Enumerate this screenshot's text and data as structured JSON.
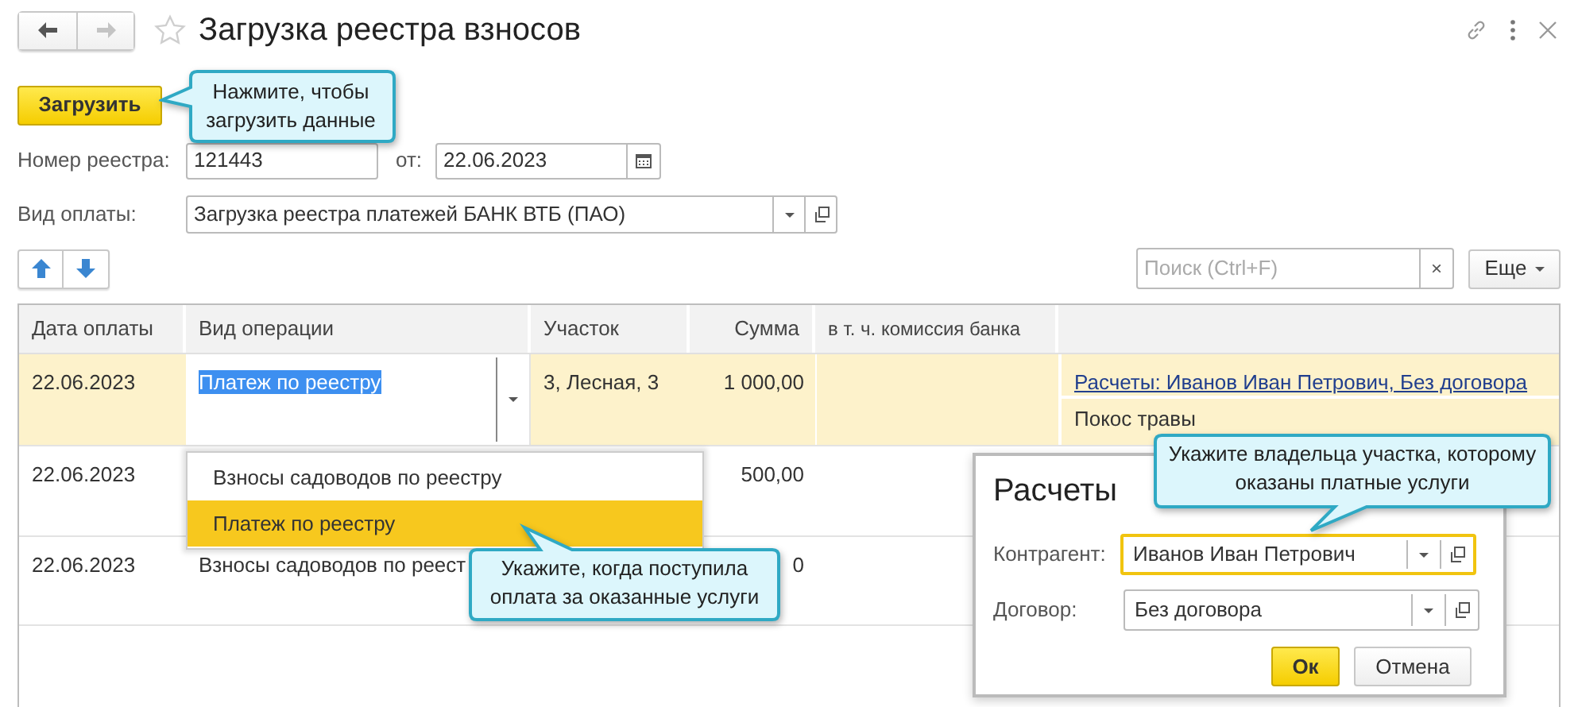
{
  "window": {
    "title": "Загрузка реестра взносов"
  },
  "navigation": [
    {
      "kind": "back",
      "disabled": false
    },
    {
      "kind": "forward",
      "disabled": true
    }
  ],
  "load_button": "Загрузить",
  "registry_number": {
    "label": "Номер реестра:",
    "value": "121443"
  },
  "date": {
    "label": "от:",
    "value": "22.06.2023"
  },
  "payment_type": {
    "label": "Вид оплаты:",
    "value": "Загрузка реестра платежей БАНК ВТБ (ПАО)"
  },
  "search": {
    "placeholder": "Поиск (Ctrl+F)",
    "clear": "×"
  },
  "more_button": "Еще",
  "table": {
    "columns": [
      "Дата оплаты",
      "Вид операции",
      "Участок",
      "Сумма",
      "в т. ч. комиссия банка"
    ],
    "rows": [
      {
        "date": "22.06.2023",
        "operation": "Платеж по реестру",
        "plot": "3, Лесная, 3",
        "sum": "1 000,00",
        "settlement": "Расчеты: Иванов Иван Петрович, Без договора",
        "service": "Покос травы",
        "selected": true
      },
      {
        "date": "22.06.2023",
        "sum": "500,00",
        "selected": false
      },
      {
        "date": "22.06.2023",
        "operation": "Взносы садоводов по реест",
        "sum": "0",
        "selected": false
      }
    ]
  },
  "operation_dropdown": {
    "items": [
      {
        "label": "Взносы садоводов по реестру",
        "selected": false
      },
      {
        "label": "Платеж по реестру",
        "selected": true
      }
    ]
  },
  "dialog": {
    "title": "Расчеты",
    "fields": [
      {
        "label": "Контрагент:",
        "value": "Иванов Иван Петрович",
        "focused": true
      },
      {
        "label": "Договор:",
        "value": "Без договора",
        "focused": false
      }
    ],
    "buttons": [
      {
        "label": "Ок",
        "kind": "primary"
      },
      {
        "label": "Отмена",
        "kind": "default"
      }
    ]
  },
  "callouts": [
    {
      "text": "Нажмите, чтобы загрузить данные"
    },
    {
      "text": "Укажите, когда поступила оплата за оказанные услуги"
    },
    {
      "text": "Укажите владельца участка, которому оказаны платные услуги"
    }
  ]
}
